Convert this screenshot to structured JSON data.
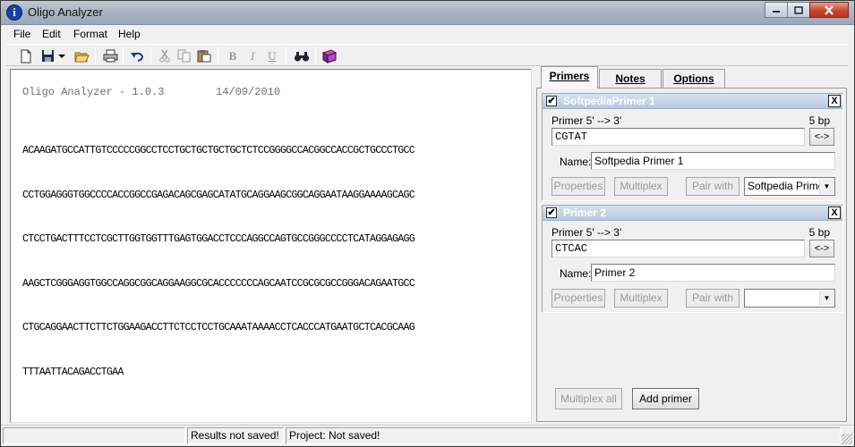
{
  "window": {
    "title": "Oligo Analyzer",
    "icon_letter": "i"
  },
  "menu": [
    "File",
    "Edit",
    "Format",
    "Help"
  ],
  "toolbar_icons": [
    "new-icon",
    "save-icon",
    "dropdown-arrow-icon",
    "open-icon",
    "print-icon",
    "undo-icon",
    "cut-icon",
    "copy-icon",
    "paste-icon",
    "bold-icon",
    "italic-icon",
    "underline-icon",
    "find-icon",
    "book-icon"
  ],
  "toolbar": {
    "bold": "B",
    "italic": "I",
    "underline": "U"
  },
  "editor": {
    "header": "Oligo Analyzer - 1.0.3        14/09/2010",
    "sequence_lines": [
      "ACAAGATGCCATTGTCCCCCGGCCTCCTGCTGCTGCTGCTCTCCGGGGCCACGGCCACCGCTGCCCTGCC",
      "CCTGGAGGGTGGCCCCACCGGCCGAGACAGCGAGCATATGCAGGAAGCGGCAGGAATAAGGAAAAGCAGC",
      "CTCCTGACTTTCCTCGCTTGGTGGTTTGAGTGGACCTCCCAGGCCAGTGCCGGGCCCCTCATAGGAGAGG",
      "AAGCTCGGGAGGTGGCCAGGCGGCAGGAAGGCGCACCCCCCCAGCAATCCGCGCGCCGGGACAGAATGCC",
      "CTGCAGGAACTTCTTCTGGAAGACCTTCTCCTCCTGCAAATAAAACCTCACCCATGAATGCTCACGCAAG",
      "TTTAATTACAGACCTGAA"
    ]
  },
  "tabs": [
    {
      "label": "Primers",
      "active": true
    },
    {
      "label": "Notes",
      "active": false
    },
    {
      "label": "Options",
      "active": false
    }
  ],
  "primers": [
    {
      "checked": true,
      "title": "SoftpediaPrimer 1",
      "direction_label": "Primer  5' --> 3'",
      "length": "5 bp",
      "sequence": "CGTAT",
      "name_label": "Name:",
      "name": "Softpedia Primer 1",
      "pair_selected": "Softpedia Primer"
    },
    {
      "checked": true,
      "title": "Primer 2",
      "direction_label": "Primer  5' --> 3'",
      "length": "5 bp",
      "sequence": "CTCAC",
      "name_label": "Name:",
      "name": "Primer 2",
      "pair_selected": ""
    }
  ],
  "buttons": {
    "close_x": "X",
    "swap": "<->",
    "properties": "Properties",
    "multiplex": "Multiplex",
    "pair_with": "Pair with",
    "multiplex_all": "Multiplex all",
    "add_primer": "Add primer",
    "check_mark": "✔"
  },
  "status": {
    "cell0": "",
    "results": "Results not saved!",
    "project": "Project: Not saved!"
  },
  "colors": {
    "card_header": "#b7c9de",
    "title_bar": "#a9b6c3"
  }
}
